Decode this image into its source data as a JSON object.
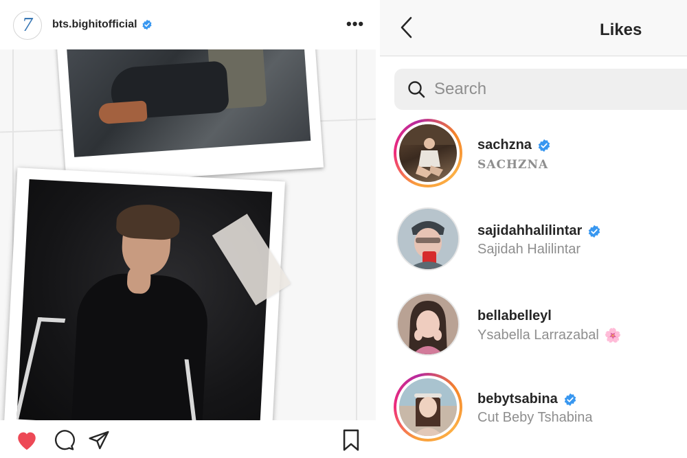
{
  "post": {
    "logo_text": "7",
    "handle": "bts.bighitofficial",
    "more_label": "•••"
  },
  "likes": {
    "title": "Likes",
    "search_placeholder": "Search",
    "users": [
      {
        "username": "sachzna",
        "full_name": "SACHZNA",
        "verified": true,
        "story_ring": true
      },
      {
        "username": "sajidahhalilintar",
        "full_name": "Sajidah Halilintar",
        "verified": true,
        "story_ring": false
      },
      {
        "username": "bellabelleyl",
        "full_name": "Ysabella Larrazabal",
        "emoji": "🌸",
        "verified": false,
        "story_ring": false
      },
      {
        "username": "bebytsabina",
        "full_name": "Cut Beby Tshabina",
        "verified": true,
        "story_ring": true
      }
    ]
  },
  "colors": {
    "like_red": "#ed4956",
    "verified_blue": "#3897f0",
    "text_dark": "#262626",
    "text_gray": "#8e8e8e"
  },
  "icons": [
    "verified-badge-icon",
    "more-options-icon",
    "heart-icon",
    "comment-icon",
    "share-icon",
    "bookmark-icon",
    "back-chevron-icon",
    "search-icon"
  ]
}
